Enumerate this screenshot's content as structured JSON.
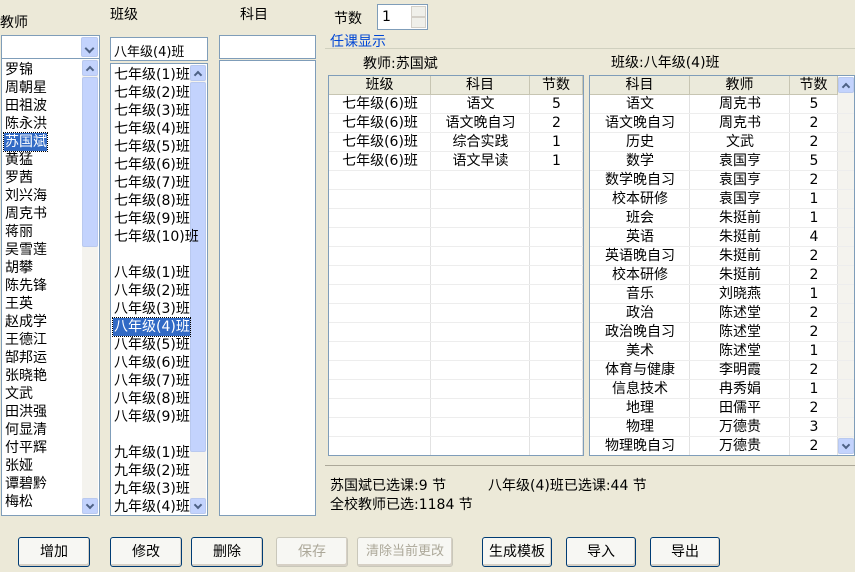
{
  "labels": {
    "teacher": "教师",
    "class": "班级",
    "subject": "科目",
    "periods": "节数",
    "display_header": "任课显示"
  },
  "class_combo": {
    "value": "八年级(4)班"
  },
  "periods_spin": {
    "value": "1"
  },
  "teachers": [
    "罗锦",
    "周朝星",
    "田祖波",
    "陈永洪",
    "苏国斌",
    "黄猛",
    "罗茜",
    "刘兴海",
    "周克书",
    "蒋丽",
    "吴雪莲",
    "胡攀",
    "陈先锋",
    "王英",
    "赵成学",
    "王德江",
    "郜邦运",
    "张晓艳",
    "文武",
    "田洪强",
    "何显清",
    "付平辉",
    "张娅",
    "谭碧黔",
    "梅松"
  ],
  "teacher_selected": 4,
  "classes": [
    "七年级(1)班",
    "七年级(2)班",
    "七年级(3)班",
    "七年级(4)班",
    "七年级(5)班",
    "七年级(6)班",
    "七年级(7)班",
    "七年级(8)班",
    "七年级(9)班",
    "七年级(10)班",
    "",
    "八年级(1)班",
    "八年级(2)班",
    "八年级(3)班",
    "八年级(4)班",
    "八年级(5)班",
    "八年级(6)班",
    "八年级(7)班",
    "八年级(8)班",
    "八年级(9)班",
    "",
    "九年级(1)班",
    "九年级(2)班",
    "九年级(3)班",
    "九年级(4)班"
  ],
  "class_selected": 14,
  "teacher_panel": {
    "title": "教师:苏国斌",
    "columns": [
      "班级",
      "科目",
      "节数"
    ],
    "rows": [
      [
        "七年级(6)班",
        "语文",
        "5"
      ],
      [
        "七年级(6)班",
        "语文晚自习",
        "2"
      ],
      [
        "七年级(6)班",
        "综合实践",
        "1"
      ],
      [
        "七年级(6)班",
        "语文早读",
        "1"
      ]
    ]
  },
  "class_panel": {
    "title": "班级:八年级(4)班",
    "columns": [
      "科目",
      "教师",
      "节数"
    ],
    "rows": [
      [
        "语文",
        "周克书",
        "5"
      ],
      [
        "语文晚自习",
        "周克书",
        "2"
      ],
      [
        "历史",
        "文武",
        "2"
      ],
      [
        "数学",
        "袁国亨",
        "5"
      ],
      [
        "数学晚自习",
        "袁国亨",
        "2"
      ],
      [
        "校本研修",
        "袁国亨",
        "1"
      ],
      [
        "班会",
        "朱挺前",
        "1"
      ],
      [
        "英语",
        "朱挺前",
        "4"
      ],
      [
        "英语晚自习",
        "朱挺前",
        "2"
      ],
      [
        "校本研修",
        "朱挺前",
        "2"
      ],
      [
        "音乐",
        "刘晓燕",
        "1"
      ],
      [
        "政治",
        "陈述堂",
        "2"
      ],
      [
        "政治晚自习",
        "陈述堂",
        "2"
      ],
      [
        "美术",
        "陈述堂",
        "1"
      ],
      [
        "体育与健康",
        "李明霞",
        "2"
      ],
      [
        "信息技术",
        "冉秀娟",
        "1"
      ],
      [
        "地理",
        "田儒平",
        "2"
      ],
      [
        "物理",
        "万德贵",
        "3"
      ],
      [
        "物理晚自习",
        "万德贵",
        "2"
      ]
    ]
  },
  "status": {
    "teacher_selected": "苏国斌已选课:9 节",
    "class_selected": "八年级(4)班已选课:44 节",
    "school_selected": "全校教师已选:1184 节"
  },
  "buttons": {
    "add": "增加",
    "modify": "修改",
    "delete": "删除",
    "save": "保存",
    "clear_changes": "清除当前更改",
    "generate_template": "生成模板",
    "import": "导入",
    "export": "导出"
  }
}
